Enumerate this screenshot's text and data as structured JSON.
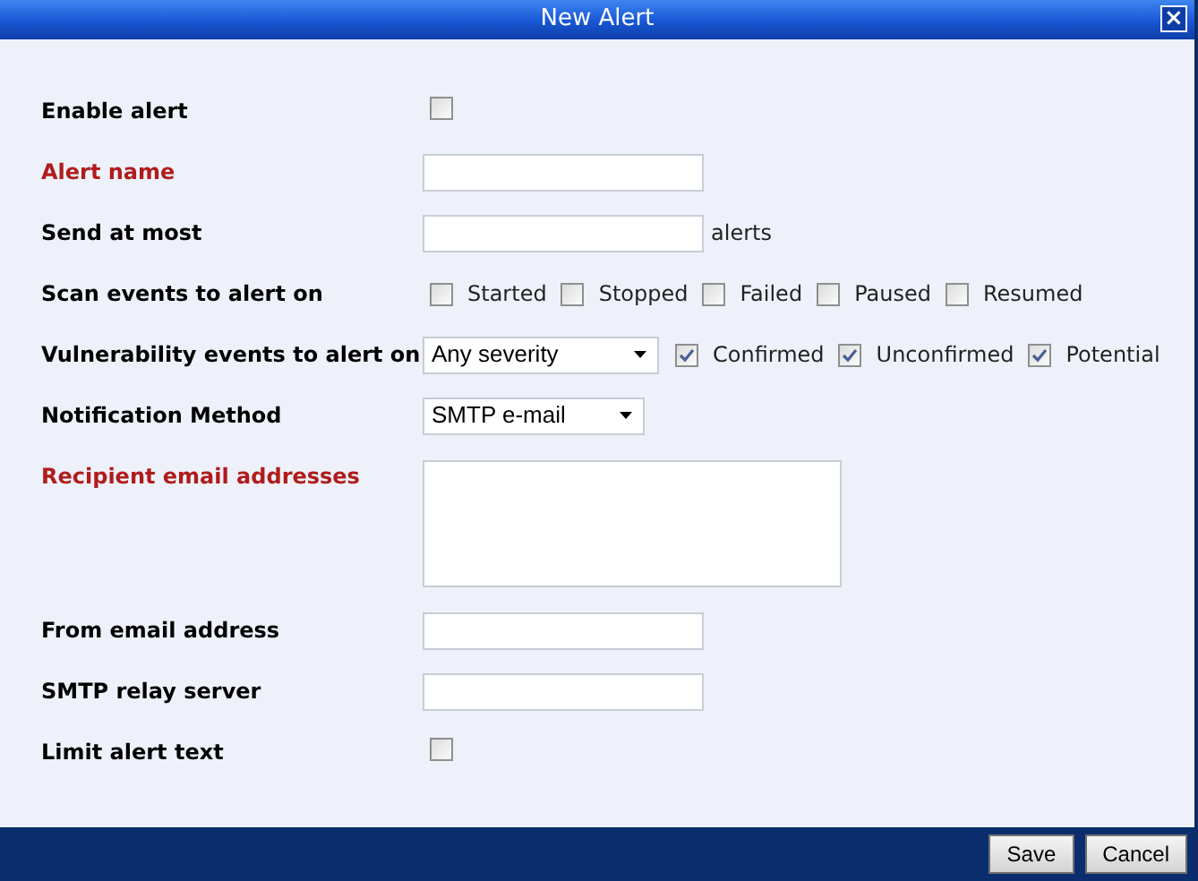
{
  "window": {
    "title": "New Alert",
    "close": "×"
  },
  "rows": [
    {
      "kind": "checkbox",
      "label": "Enable alert",
      "required": false,
      "checked": false
    },
    {
      "kind": "text",
      "label": "Alert name",
      "required": true
    },
    {
      "kind": "text",
      "label": "Send at most",
      "required": false,
      "suffix": "alerts"
    },
    {
      "kind": "checks",
      "label": "Scan events to alert on",
      "required": false,
      "options": [
        {
          "label": "Started",
          "checked": false
        },
        {
          "label": "Stopped",
          "checked": false
        },
        {
          "label": "Failed",
          "checked": false
        },
        {
          "label": "Paused",
          "checked": false
        },
        {
          "label": "Resumed",
          "checked": false
        }
      ]
    },
    {
      "kind": "select-checks",
      "label": "Vulnerability events to alert on",
      "required": false,
      "value": "Any severity",
      "options": [
        {
          "label": "Confirmed",
          "checked": true
        },
        {
          "label": "Unconfirmed",
          "checked": true
        },
        {
          "label": "Potential",
          "checked": true
        }
      ]
    },
    {
      "kind": "select",
      "label": "Notification Method",
      "required": false,
      "value": "SMTP e-mail"
    },
    {
      "kind": "textarea",
      "label": "Recipient email addresses",
      "required": true
    },
    {
      "kind": "text",
      "label": "From email address",
      "required": false
    },
    {
      "kind": "text",
      "label": "SMTP relay server",
      "required": false
    },
    {
      "kind": "checkbox",
      "label": "Limit alert text",
      "required": false,
      "checked": false
    }
  ],
  "buttons": [
    "Save",
    "Cancel"
  ]
}
